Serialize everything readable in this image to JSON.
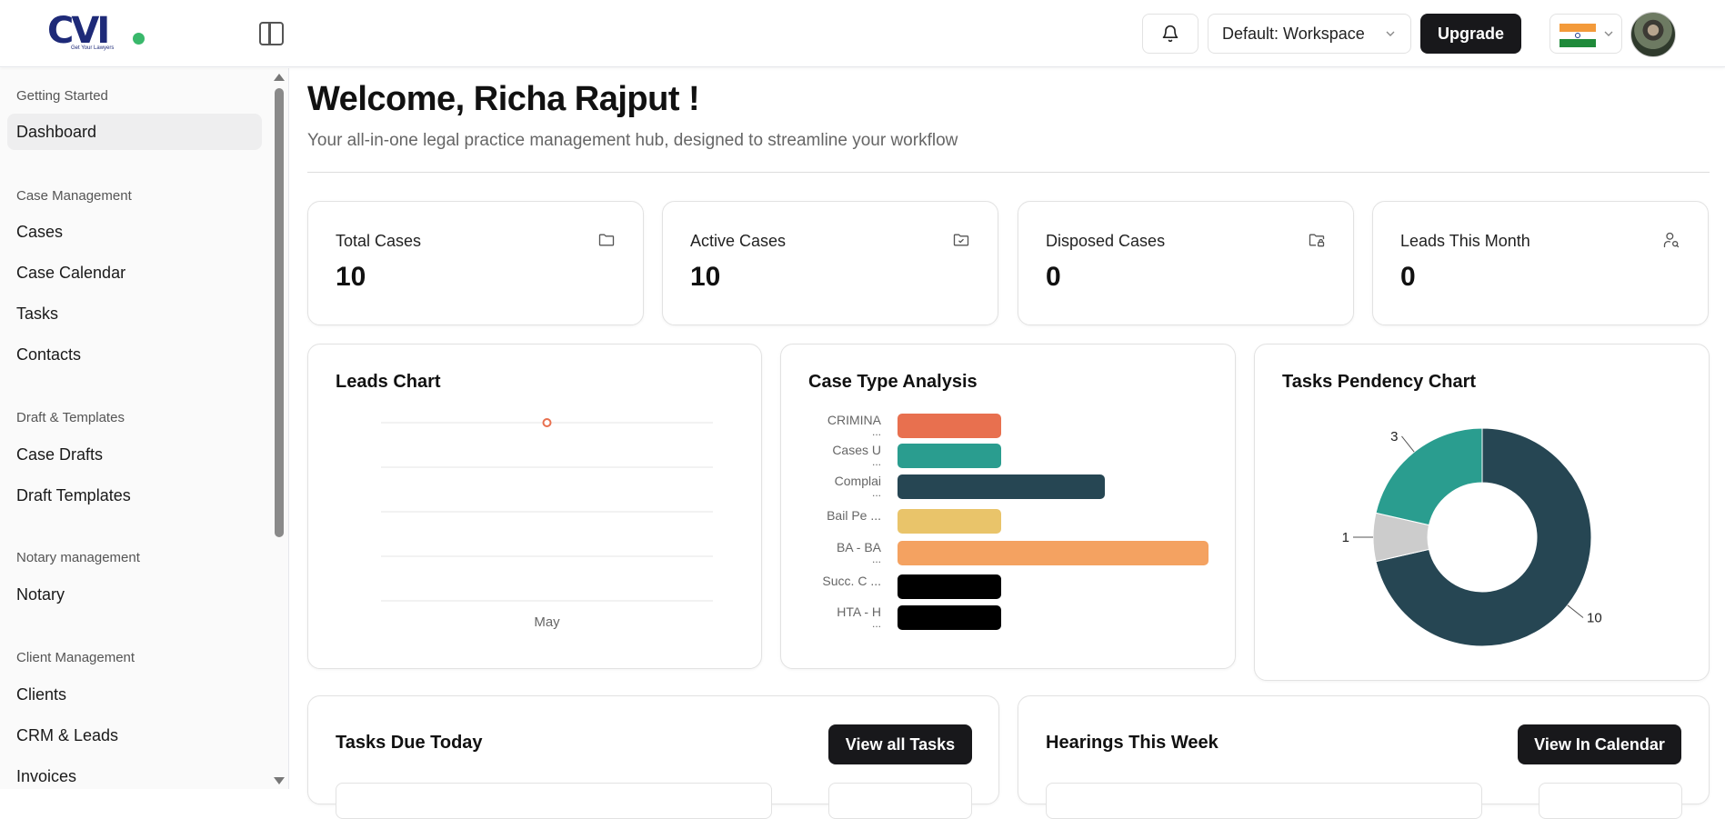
{
  "header": {
    "logo_text": "CVI",
    "logo_tagline": "Get Your Lawyers",
    "workspace_label": "Default: Workspace",
    "upgrade_label": "Upgrade"
  },
  "sidebar": {
    "sections": [
      {
        "label": "Getting Started",
        "items": [
          {
            "label": "Dashboard",
            "active": true
          }
        ]
      },
      {
        "label": "Case Management",
        "items": [
          {
            "label": "Cases"
          },
          {
            "label": "Case Calendar"
          },
          {
            "label": "Tasks"
          },
          {
            "label": "Contacts"
          }
        ]
      },
      {
        "label": "Draft & Templates",
        "items": [
          {
            "label": "Case Drafts"
          },
          {
            "label": "Draft Templates"
          }
        ]
      },
      {
        "label": "Notary management",
        "items": [
          {
            "label": "Notary"
          }
        ]
      },
      {
        "label": "Client Management",
        "items": [
          {
            "label": "Clients"
          },
          {
            "label": "CRM & Leads"
          },
          {
            "label": "Invoices"
          }
        ]
      }
    ]
  },
  "main": {
    "welcome": "Welcome, Richa Rajput !",
    "subtitle": "Your all-in-one legal practice management hub, designed to streamline your workflow",
    "stats": [
      {
        "label": "Total Cases",
        "value": "10",
        "icon": "folder-icon"
      },
      {
        "label": "Active Cases",
        "value": "10",
        "icon": "folder-check-icon"
      },
      {
        "label": "Disposed Cases",
        "value": "0",
        "icon": "folder-lock-icon"
      },
      {
        "label": "Leads This Month",
        "value": "0",
        "icon": "user-search-icon"
      }
    ],
    "leads_chart_title": "Leads Chart",
    "case_type_title": "Case Type Analysis",
    "tasks_chart_title": "Tasks Pendency Chart",
    "tasks_due_title": "Tasks Due Today",
    "tasks_due_button": "View all Tasks",
    "hearings_title": "Hearings This Week",
    "hearings_button": "View In Calendar"
  },
  "chart_data": [
    {
      "type": "line",
      "title": "Leads Chart",
      "categories": [
        "May"
      ],
      "series": [
        {
          "values": [
            0
          ]
        }
      ],
      "grid": true,
      "color": "#e8704f"
    },
    {
      "type": "bar",
      "orientation": "horizontal",
      "title": "Case Type Analysis",
      "categories": [
        "CRIMINA ...",
        "Cases U ...",
        "Complai ...",
        "Bail Pe ...",
        "BA - BA ...",
        "Succ. C ...",
        "HTA - H ..."
      ],
      "values": [
        1,
        1,
        2,
        1,
        3,
        1,
        1
      ],
      "colors": [
        "#e8704f",
        "#2a9d8f",
        "#264653",
        "#e9c46a",
        "#f4a261",
        "#000000",
        "#000000"
      ]
    },
    {
      "type": "pie",
      "title": "Tasks Pendency Chart",
      "labels": [
        "10",
        "1",
        "3"
      ],
      "values": [
        10,
        1,
        3
      ],
      "colors": [
        "#264653",
        "#cccccc",
        "#2a9d8f"
      ],
      "donut": true
    }
  ]
}
